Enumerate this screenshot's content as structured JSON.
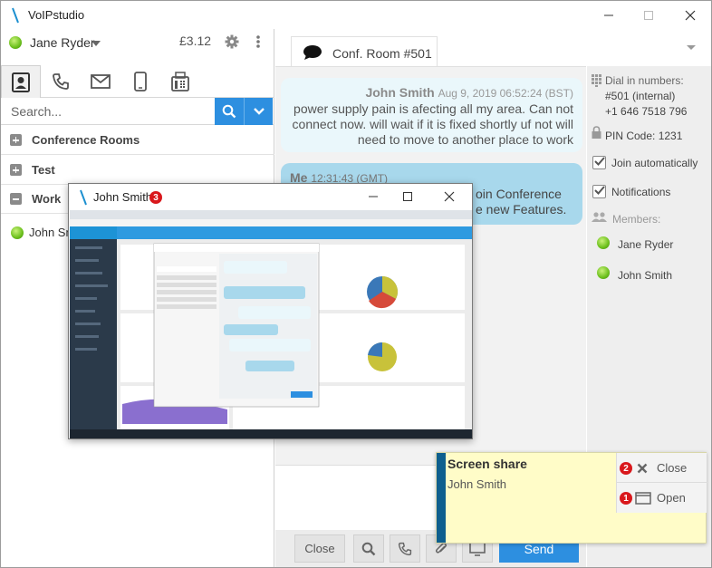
{
  "app": {
    "title": "VoIPstudio"
  },
  "user": {
    "name": "Jane Ryder",
    "balance": "£3.12"
  },
  "search": {
    "placeholder": "Search..."
  },
  "groups": [
    {
      "label": "Conference Rooms",
      "state": "collapsed"
    },
    {
      "label": "Test",
      "state": "collapsed"
    },
    {
      "label": "Work",
      "state": "expanded"
    }
  ],
  "contacts": [
    {
      "name": "John Sm"
    }
  ],
  "chat": {
    "tab_label": "Conf. Room #501",
    "messages": [
      {
        "author": "John Smith",
        "time": "Aug 9, 2019 06:52:24 (BST)",
        "text": "power supply pain is afecting all my area. Can not connect now. will wait if it is fixed shortly uf not will need to move to another place to work"
      },
      {
        "author": "Me",
        "time": "12:31:43 (GMT)",
        "text_line1": "oin Conference",
        "text_line2": "e new Features."
      }
    ]
  },
  "bottom_bar": {
    "close_label": "Close",
    "send_label": "Send"
  },
  "info": {
    "dial_label": "Dial in numbers:",
    "dial_internal": "#501 (internal)",
    "dial_external": "+1 646 7518 796",
    "pin_label": "PIN Code: 1231",
    "join_auto": "Join automatically",
    "notifications": "Notifications",
    "members_label": "Members:",
    "members": [
      "Jane Ryder",
      "John Smith"
    ]
  },
  "preview": {
    "title": "John Smith",
    "badge": "3"
  },
  "notification": {
    "title": "Screen share",
    "subtitle": "John Smith",
    "close_label": "Close",
    "close_badge": "2",
    "open_label": "Open",
    "open_badge": "1"
  },
  "colors": {
    "accent": "#2d8fe0",
    "online": "#6bbf1c",
    "badge": "#d9181c",
    "notify_bg": "#fffcc8"
  }
}
